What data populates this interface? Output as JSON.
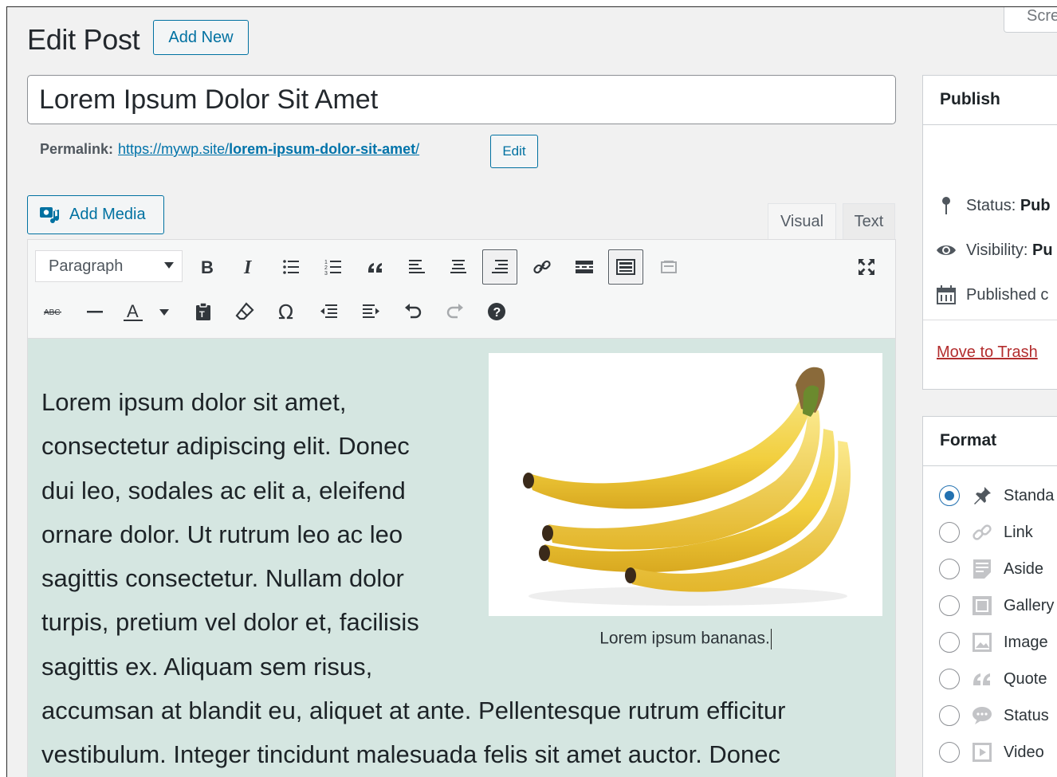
{
  "header": {
    "title": "Edit Post",
    "add_new_label": "Add New",
    "screen_options_label": "Scre"
  },
  "post": {
    "title_value": "Lorem Ipsum Dolor Sit Amet",
    "permalink_label": "Permalink:",
    "permalink_base": "https://mywp.site/",
    "permalink_slug": "lorem-ipsum-dolor-sit-amet",
    "permalink_trail": "/",
    "edit_slug_label": "Edit"
  },
  "editor": {
    "add_media_label": "Add Media",
    "tab_visual": "Visual",
    "tab_text": "Text",
    "format_select_value": "Paragraph",
    "text_lines_narrow": [
      "Lorem ipsum dolor sit amet,",
      "consectetur adipiscing elit. Donec",
      "dui leo, sodales ac elit a, eleifend",
      "ornare dolor. Ut rutrum leo ac leo",
      "sagittis consectetur. Nullam dolor",
      "turpis, pretium vel dolor et, facilisis",
      "sagittis ex. Aliquam sem risus,"
    ],
    "text_lines_wide": [
      "accumsan at blandit eu, aliquet at ante. Pellentesque rutrum efficitur",
      "vestibulum. Integer tincidunt malesuada felis sit amet auctor. Donec"
    ],
    "image_caption": "Lorem ipsum bananas.",
    "content_bg": "#d5e6e1"
  },
  "publish_box": {
    "title": "Publish",
    "status_label": "Status:",
    "status_value": "Pub",
    "visibility_label": "Visibility:",
    "visibility_value": "Pu",
    "published_label": "Published c",
    "trash_label": "Move to Trash"
  },
  "format_box": {
    "title": "Format",
    "options": [
      "Standa",
      "Link",
      "Aside",
      "Gallery",
      "Image",
      "Quote",
      "Status",
      "Video"
    ],
    "selected": "Standa"
  },
  "colors": {
    "accent": "#0071a1",
    "trash": "#b32d2e",
    "radio_checked": "#2271b1"
  }
}
